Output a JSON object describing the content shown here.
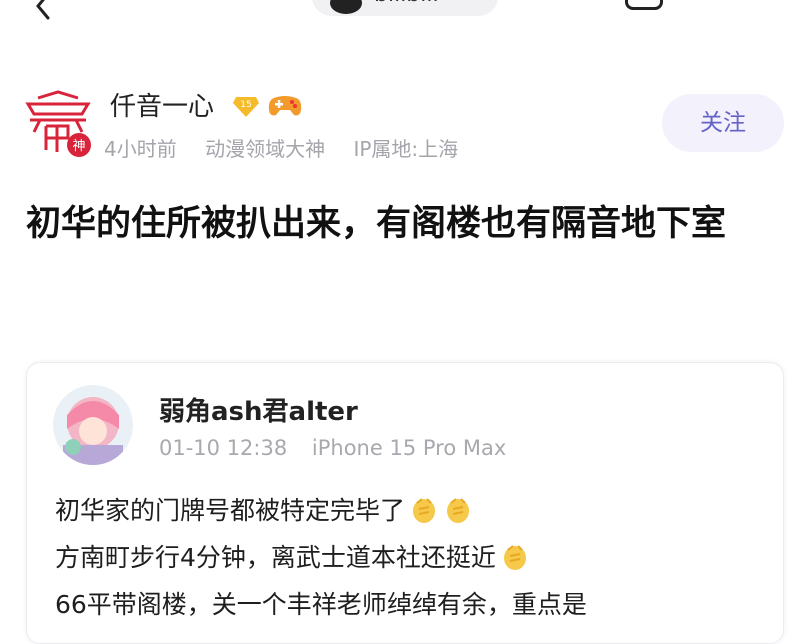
{
  "header": {
    "back_icon": "back-arrow-icon",
    "tab_label": "bilibili",
    "share_icon": "share-icon"
  },
  "author": {
    "name": "仟音一心",
    "level": "15",
    "level_icon": "diamond-level-badge-icon",
    "game_icon": "gamepad-icon",
    "avatar_badge": "神",
    "time": "4小时前",
    "title": "动漫领域大神",
    "ip": "IP属地:上海",
    "follow_label": "关注"
  },
  "post": {
    "title": "初华的住所被扒出来，有阁楼也有隔音地下室"
  },
  "quote": {
    "name": "弱角ash君alter",
    "time": "01-10 12:38",
    "device": "iPhone 15 Pro Max",
    "lines": [
      "初华家的门牌号都被特定完毕了",
      "方南町步行4分钟，离武士道本社还挺近",
      "66平带阁楼，关一个丰祥老师绰绰有余，重点是"
    ],
    "emoji_name": "clapping-hands-emoji"
  },
  "colors": {
    "accent": "#6563c6",
    "follow_bg": "#f2f1fc",
    "meta_gray": "#a4a4ab",
    "avatar_red": "#d8243a"
  }
}
